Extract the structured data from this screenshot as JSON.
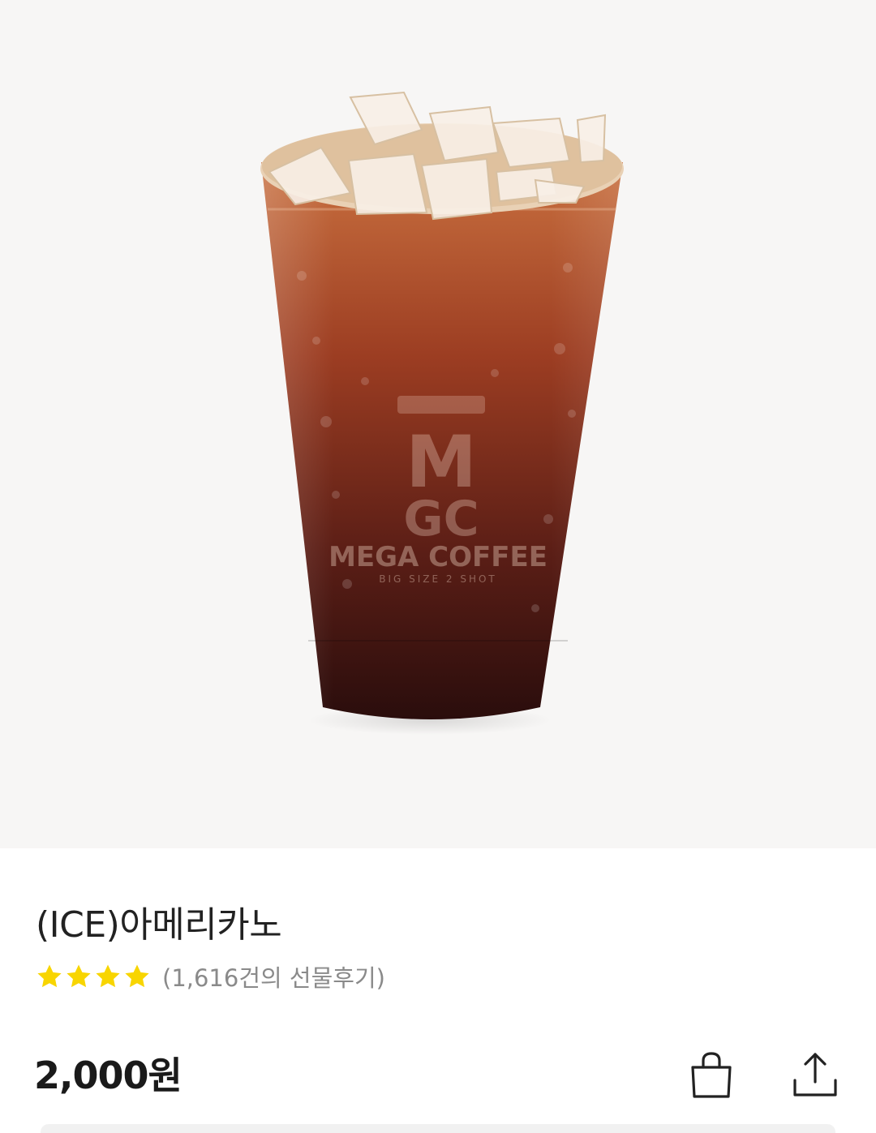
{
  "product": {
    "title": "(ICE)아메리카노",
    "rating_stars": 4,
    "review_count_text": "(1,616건의 선물후기)",
    "price": "2,000원",
    "image_brand_name": "MEGA COFFEE",
    "image_brand_tagline": "BIG SIZE 2 SHOT",
    "image_logo_text": "MGC"
  },
  "actions": {
    "bag_icon": "shopping-bag-icon",
    "share_icon": "share-icon"
  },
  "colors": {
    "star": "#f8d500",
    "hero_bg": "#f7f6f5",
    "price_text": "#1a1a1a"
  }
}
